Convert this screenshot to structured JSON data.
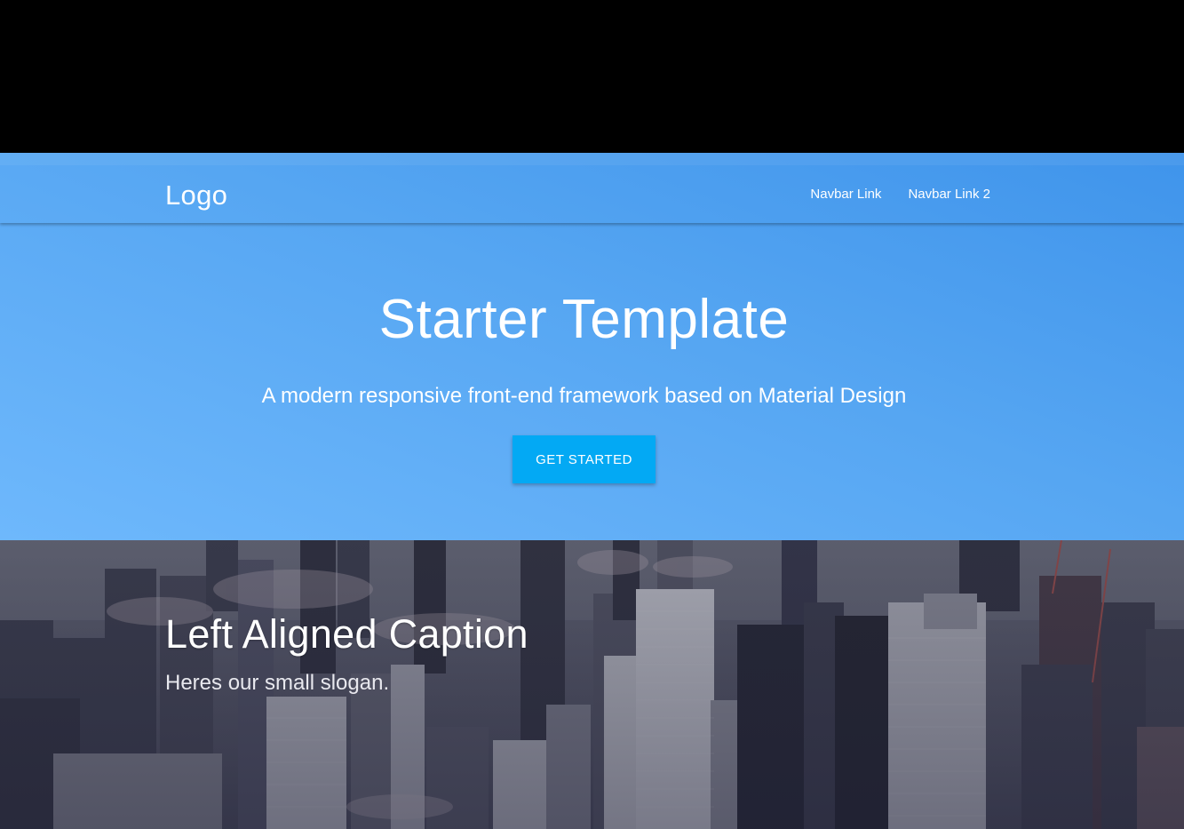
{
  "navbar": {
    "logo": "Logo",
    "links": [
      "Navbar Link",
      "Navbar Link 2"
    ]
  },
  "hero": {
    "title": "Starter Template",
    "subtitle": "A modern responsive front-end framework based on Material Design",
    "button_label": "GET STARTED"
  },
  "parallax": {
    "caption_title": "Left Aligned Caption",
    "caption_slogan": "Heres our small slogan."
  },
  "colors": {
    "hero_gradient_start": "#6eb8fc",
    "hero_gradient_end": "#3f94eb",
    "button": "#03a9f4",
    "parallax_overlay": "#3a3d55"
  }
}
